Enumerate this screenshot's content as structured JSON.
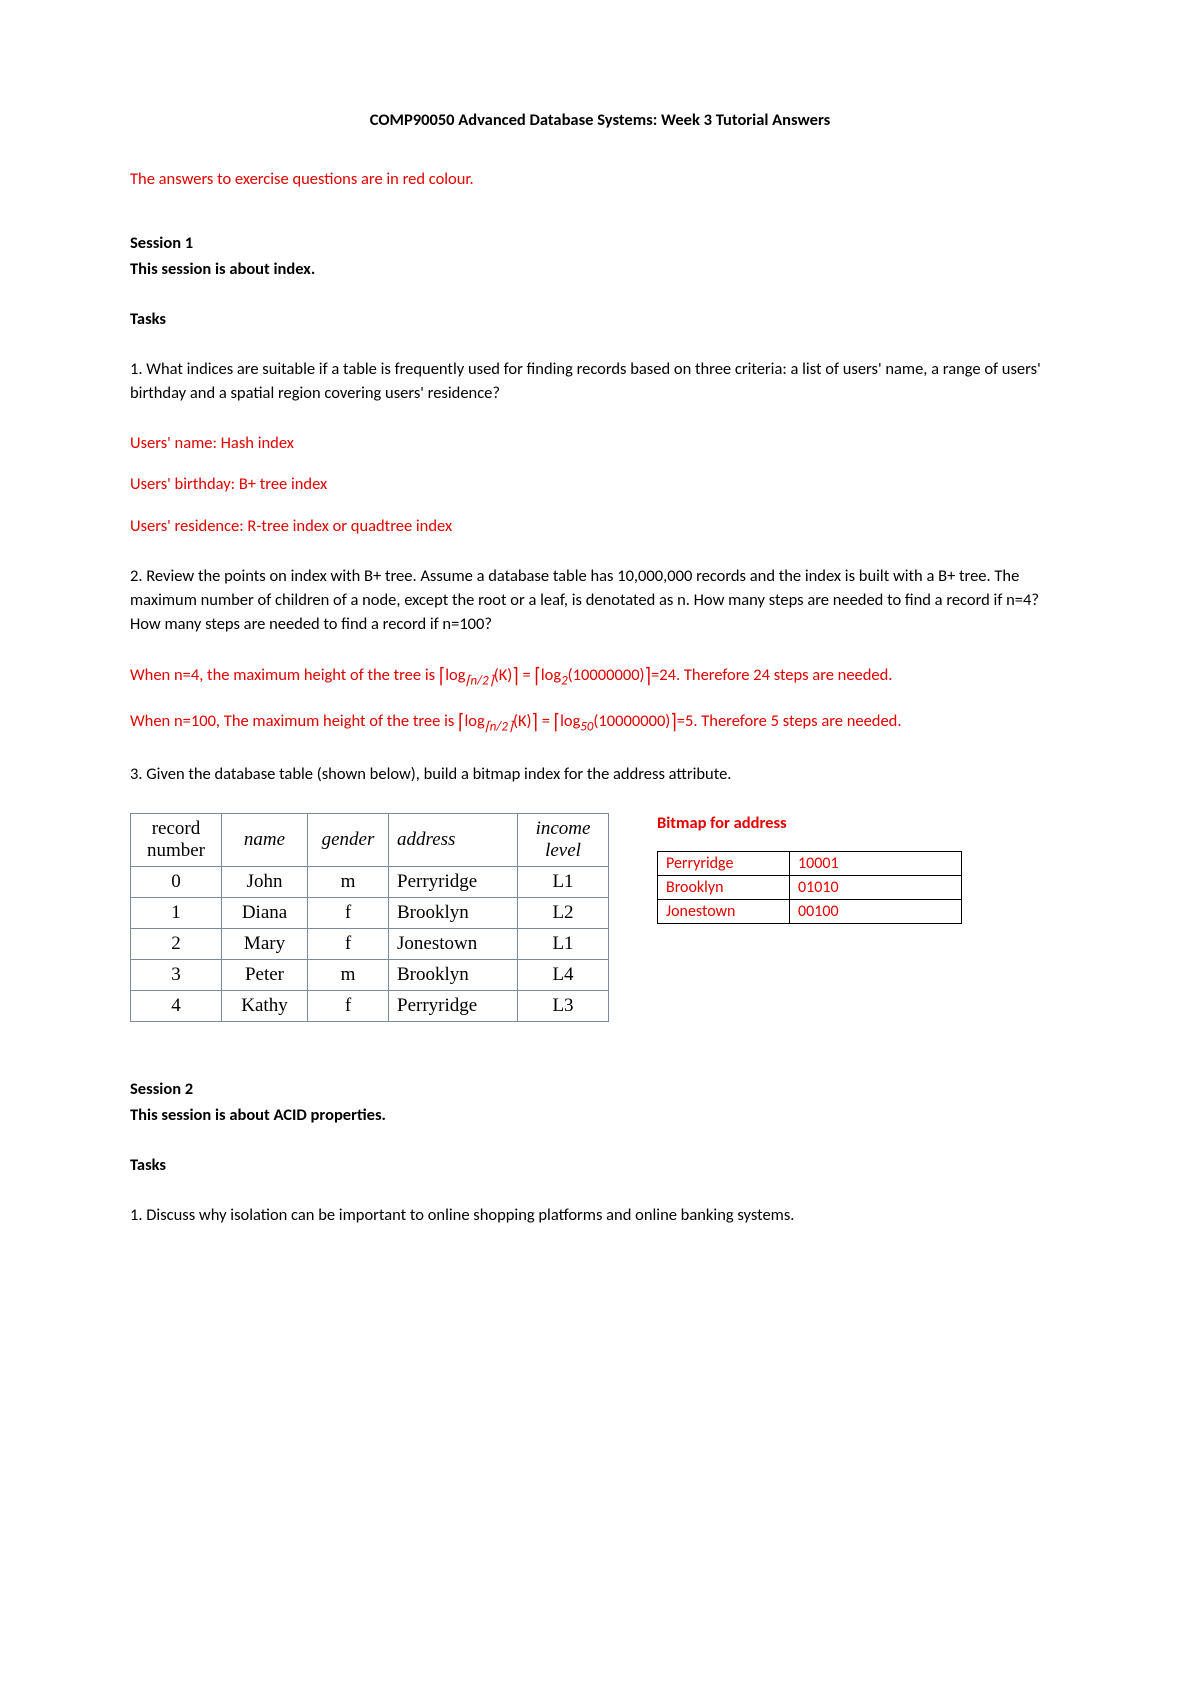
{
  "title": "COMP90050 Advanced Database Systems: Week 3 Tutorial Answers",
  "intro_red": "The answers to exercise questions are in red colour.",
  "session1": {
    "heading": "Session 1",
    "subheading": "This session is about index.",
    "tasks_label": "Tasks",
    "q1": "1. What indices are suitable if a table is frequently used for finding records based on three criteria: a list of users' name, a range of users' birthday and a spatial region covering users' residence?",
    "a1_line1": "Users' name: Hash index",
    "a1_line2": "Users' birthday: B+ tree index",
    "a1_line3": "Users' residence: R-tree index or quadtree index",
    "q2": "2. Review the points on index with B+ tree. Assume a database table has 10,000,000 records and the index is built with a B+ tree. The maximum number of children of a node, except the root or a leaf, is denotated as n. How many steps are needed to find a record if n=4? How many steps are needed to find a record if n=100?",
    "a2_line1_pre": "When n=4, the maximum height of the tree is ",
    "a2_line1_f1_sub": "n/2",
    "a2_line1_f1_arg": "(K)",
    "a2_line1_mid": " = ",
    "a2_line1_f2_sub": "2",
    "a2_line1_f2_arg": "(10000000)",
    "a2_line1_post": "=24. Therefore 24 steps are needed.",
    "a2_line2_pre": "When n=100, The maximum height of the tree is ",
    "a2_line2_f1_sub": "n/2",
    "a2_line2_f1_arg": "(K)",
    "a2_line2_mid": " = ",
    "a2_line2_f2_sub": "50",
    "a2_line2_f2_arg": "(10000000)",
    "a2_line2_post": "=5. Therefore 5 steps are needed.",
    "q3": "3. Given the database table (shown below), build a bitmap index for the address attribute."
  },
  "table": {
    "headers": {
      "record": "record number",
      "name": "name",
      "gender": "gender",
      "address": "address",
      "income": "income level"
    },
    "rows": [
      {
        "rec": "0",
        "name": "John",
        "gender": "m",
        "address": "Perryridge",
        "income": "L1"
      },
      {
        "rec": "1",
        "name": "Diana",
        "gender": "f",
        "address": "Brooklyn",
        "income": "L2"
      },
      {
        "rec": "2",
        "name": "Mary",
        "gender": "f",
        "address": "Jonestown",
        "income": "L1"
      },
      {
        "rec": "3",
        "name": "Peter",
        "gender": "m",
        "address": "Brooklyn",
        "income": "L4"
      },
      {
        "rec": "4",
        "name": "Kathy",
        "gender": "f",
        "address": "Perryridge",
        "income": "L3"
      }
    ]
  },
  "bitmap": {
    "title": "Bitmap for address",
    "rows": [
      {
        "key": "Perryridge",
        "val": "10001"
      },
      {
        "key": "Brooklyn",
        "val": "01010"
      },
      {
        "key": "Jonestown",
        "val": "00100"
      }
    ]
  },
  "session2": {
    "heading": "Session 2",
    "subheading": "This session is about ACID properties.",
    "tasks_label": "Tasks",
    "q1": "1. Discuss why isolation can be important to online shopping platforms and online banking systems."
  },
  "glyphs": {
    "log": "log",
    "ceil_l": "⌈",
    "ceil_r": "⌉"
  }
}
